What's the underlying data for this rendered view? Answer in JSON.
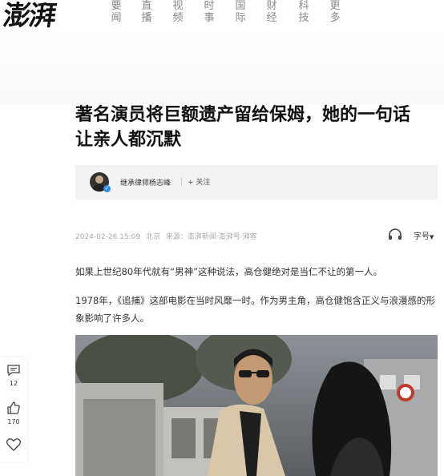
{
  "header": {
    "logo_text": "澎湃",
    "nav": [
      "要闻",
      "直播",
      "视频",
      "时事",
      "国际",
      "财经",
      "科技",
      "更多"
    ]
  },
  "article": {
    "title_line1": "著名演员将巨额遗产留给保姆，她的一句话",
    "title_line2": "让亲人都沉默",
    "author": {
      "name": "继承律师杨志峰",
      "follow_label": "+ 关注"
    },
    "meta": {
      "datetime": "2024-02-26 15:09",
      "location": "北京",
      "source": "来源：澎湃新闻·澎湃号·湃客"
    },
    "font_size_label": "字号",
    "paragraphs": [
      "如果上世纪80年代就有“男神”这种说法，高仓健绝对是当仁不让的第一人。",
      "1978年，《追捕》这部电影在当时风靡一时。作为男主角，高仓健饱含正义与浪漫感的形象影响了许多人。"
    ]
  },
  "sidebar": {
    "comment_count": "12",
    "like_count": "170"
  },
  "icons": [
    "headphone-icon",
    "caret-down-icon",
    "comment-icon",
    "thumbs-up-icon",
    "heart-icon",
    "verified-icon"
  ],
  "colors": {
    "accent": "#2d8cf0",
    "title": "#111111",
    "nav": "#888888"
  }
}
